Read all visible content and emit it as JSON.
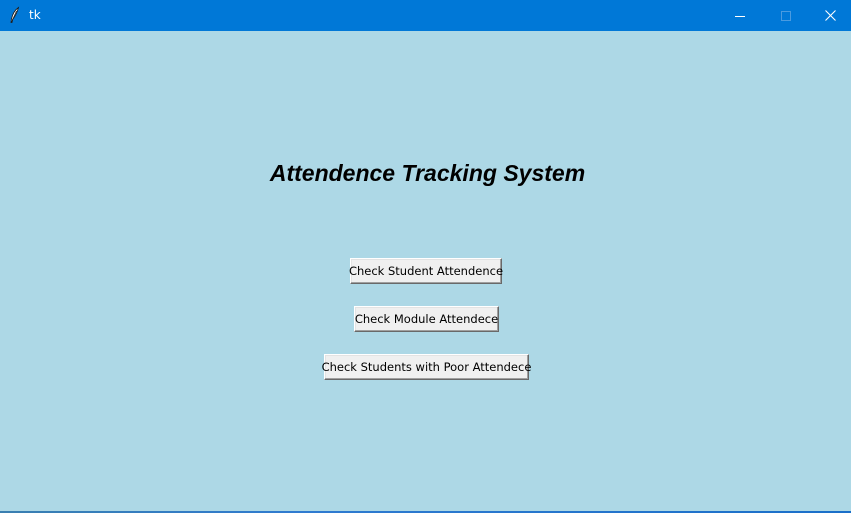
{
  "window": {
    "title": "tk",
    "colors": {
      "titlebar": "#0078d7",
      "background": "#add8e6",
      "button_face": "#f0f0f0"
    },
    "controls": {
      "minimize_icon": "minimize-icon",
      "maximize_icon": "maximize-icon",
      "close_icon": "close-icon"
    }
  },
  "main": {
    "title": "Attendence Tracking System",
    "buttons": [
      {
        "label": "Check Student Attendence"
      },
      {
        "label": "Check Module Attendece"
      },
      {
        "label": "Check Students with Poor Attendece"
      }
    ]
  }
}
